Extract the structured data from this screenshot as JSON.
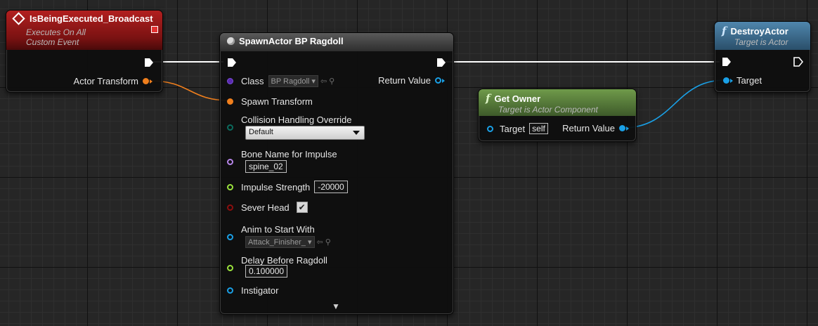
{
  "event_node": {
    "title": "IsBeingExecuted_Broadcast",
    "subtitle_1": "Executes On All",
    "subtitle_2": "Custom Event",
    "pin_actor_transform": "Actor Transform"
  },
  "spawn_node": {
    "title": "SpawnActor BP Ragdoll",
    "class_label": "Class",
    "class_value": "BP Ragdoll",
    "return_value": "Return Value",
    "spawn_transform": "Spawn Transform",
    "collision_label": "Collision Handling Override",
    "collision_value": "Default",
    "bone_label": "Bone Name for Impulse",
    "bone_value": "spine_02",
    "impulse_label": "Impulse Strength",
    "impulse_value": "-20000",
    "sever_label": "Sever Head",
    "sever_checked": "✔",
    "anim_label": "Anim to Start With",
    "anim_value": "Attack_Finisher_",
    "delay_label": "Delay Before Ragdoll",
    "delay_value": "0.100000",
    "instigator_label": "Instigator",
    "expand_glyph": "▼"
  },
  "get_owner_node": {
    "title": "Get Owner",
    "subtitle": "Target is Actor Component",
    "target_label": "Target",
    "target_value": "self",
    "return_value": "Return Value"
  },
  "destroy_node": {
    "title": "DestroyActor",
    "subtitle": "Target is Actor",
    "target_label": "Target"
  },
  "colors": {
    "event_header": "#8a1414",
    "function_header_blue": "#3b6f93",
    "function_header_green": "#557a3a",
    "exec_wire": "#ffffff",
    "transform_pin": "#f07f1d",
    "object_pin": "#1aa0e6",
    "class_pin": "#5a2bb0",
    "enum_pin": "#0b6b5e",
    "name_pin": "#b685e8",
    "float_pin": "#9ae23c",
    "bool_pin": "#8c0e0e"
  },
  "icons": {
    "event": "event-diamond-icon",
    "function": "function-f-icon",
    "spawn": "spawn-actor-icon",
    "browse": "browse-arrow-icon",
    "search": "search-icon"
  }
}
